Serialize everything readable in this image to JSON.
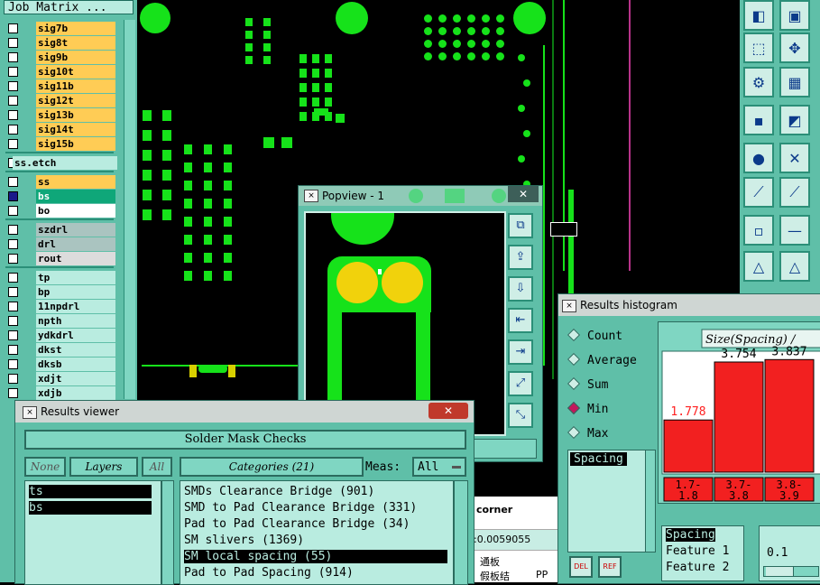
{
  "job_matrix": {
    "title": "Job Matrix ..."
  },
  "layers": [
    {
      "name": "sig7b",
      "color": "#ffcc55"
    },
    {
      "name": "sig8t",
      "color": "#ffcc55"
    },
    {
      "name": "sig9b",
      "color": "#ffcc55"
    },
    {
      "name": "sig10t",
      "color": "#ffcc55"
    },
    {
      "name": "sig11b",
      "color": "#ffcc55"
    },
    {
      "name": "sig12t",
      "color": "#ffcc55"
    },
    {
      "name": "sig13b",
      "color": "#ffcc55"
    },
    {
      "name": "sig14t",
      "color": "#ffcc55"
    },
    {
      "name": "sig15b",
      "color": "#ffcc55"
    },
    {
      "name": "ss.etch",
      "color": "#b9ece0"
    },
    {
      "name": "ss",
      "color": "#ffcc55"
    },
    {
      "name": "bs",
      "color": "#0fa779"
    },
    {
      "name": "bo",
      "color": "#ffffff"
    },
    {
      "name": "szdrl",
      "color": "#aac4c0"
    },
    {
      "name": "drl",
      "color": "#aac4c0"
    },
    {
      "name": "rout",
      "color": "#dcdcdc"
    },
    {
      "name": "tp",
      "color": "#b9ece0"
    },
    {
      "name": "bp",
      "color": "#b9ece0"
    },
    {
      "name": "11npdrl",
      "color": "#b9ece0"
    },
    {
      "name": "npth",
      "color": "#b9ece0"
    },
    {
      "name": "ydkdrl",
      "color": "#b9ece0"
    },
    {
      "name": "dkst",
      "color": "#b9ece0"
    },
    {
      "name": "dksb",
      "color": "#b9ece0"
    },
    {
      "name": "xdjt",
      "color": "#b9ece0"
    },
    {
      "name": "xdjb",
      "color": "#b9ece0"
    }
  ],
  "popview": {
    "title": "Popview - 1",
    "close": "✕"
  },
  "results_viewer": {
    "title": "Results viewer",
    "close": "✕",
    "header": "Solder Mask Checks",
    "btn_none": "None",
    "btn_layers": "Layers",
    "btn_all": "All",
    "categories_label": "Categories (21)",
    "meas_label": "Meas:",
    "meas_value": "All",
    "layer_items": [
      "ts",
      "bs"
    ],
    "category_items": [
      "SMDs Clearance Bridge (901)",
      "SMD to Pad Clearance Bridge (331)",
      "Pad to Pad Clearance Bridge (34)",
      "SM slivers (1369)",
      "SM local spacing (55)",
      "Pad to Pad Spacing (914)"
    ]
  },
  "behind": {
    "corner": "corner",
    "value": ":0.0059055",
    "cn1": "通板",
    "cn2": "假板结",
    "pp": "PP"
  },
  "histogram": {
    "title": "Results histogram",
    "options": [
      "Count",
      "Average",
      "Sum",
      "Min",
      "Max"
    ],
    "selected": "Min",
    "list_item": "Spacing",
    "bottom_items": [
      "Spacing",
      "Feature 1",
      "Feature 2"
    ],
    "btn_del": "DEL",
    "btn_ref": "REF",
    "slider_value": "0.1"
  },
  "chart_data": {
    "type": "bar",
    "title": "Size(Spacing) /",
    "categories": [
      "1.7-\n1.8",
      "3.7-\n3.8",
      "3.8-\n3.9"
    ],
    "values": [
      1.778,
      3.754,
      3.837
    ],
    "value_labels": [
      "1.778",
      "3.754",
      "3.837"
    ],
    "label_colors": [
      "#ff2020",
      "#000000",
      "#000000"
    ],
    "bar_color": "#f22020"
  }
}
